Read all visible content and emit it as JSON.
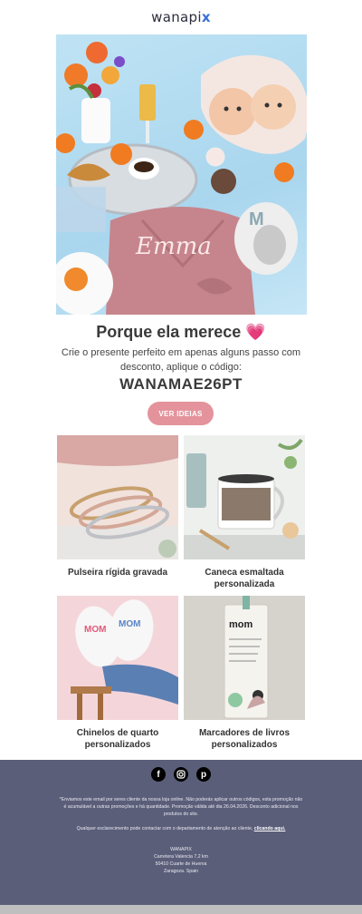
{
  "header": {
    "logo_text": "wanapi",
    "logo_accent": "x"
  },
  "hero": {
    "image": "gift-set-photo",
    "name_on_robe": "Emma"
  },
  "promo": {
    "title": "Porque ela merece",
    "title_emoji": "💗",
    "subtitle": "Crie o presente perfeito em apenas alguns passo com desconto, aplique o código:",
    "code": "WANAMAE26PT",
    "cta_label": "VER IDEIAS"
  },
  "products": [
    {
      "label": "Pulseira rígida gravada",
      "icon": "bracelet-photo"
    },
    {
      "label": "Caneca esmaltada personalizada",
      "icon": "mug-photo"
    },
    {
      "label": "Chinelos de quarto personalizados",
      "icon": "slippers-photo"
    },
    {
      "label": "Marcadores de livros personalizados",
      "icon": "bookmark-photo"
    }
  ],
  "footer": {
    "social": [
      "facebook-icon",
      "instagram-icon",
      "pinterest-icon"
    ],
    "legal": "*Enviamos este email por seres cliente da nossa loja online. Não poderás aplicar outros códigos, esta promoção não é acumulável a outras promoções e há quantidade. Promoção válida até dia 26.04.2026. Desconto adicional nos produtos do site.",
    "help_text": "Qualquer esclarecimento pode contactar com o departamento de atenção ao cliente,",
    "help_link": "clicando aqui.",
    "company": "WANAPIX",
    "address_1": "Carretera Valencia 7,2 km",
    "address_2": "50410 Cuarte de Huerva",
    "address_3": "Zaragoza. Spain"
  },
  "colors": {
    "accent": "#e4939c",
    "footer_bg": "#5b5e79",
    "logo_accent": "#3a6fd8"
  }
}
